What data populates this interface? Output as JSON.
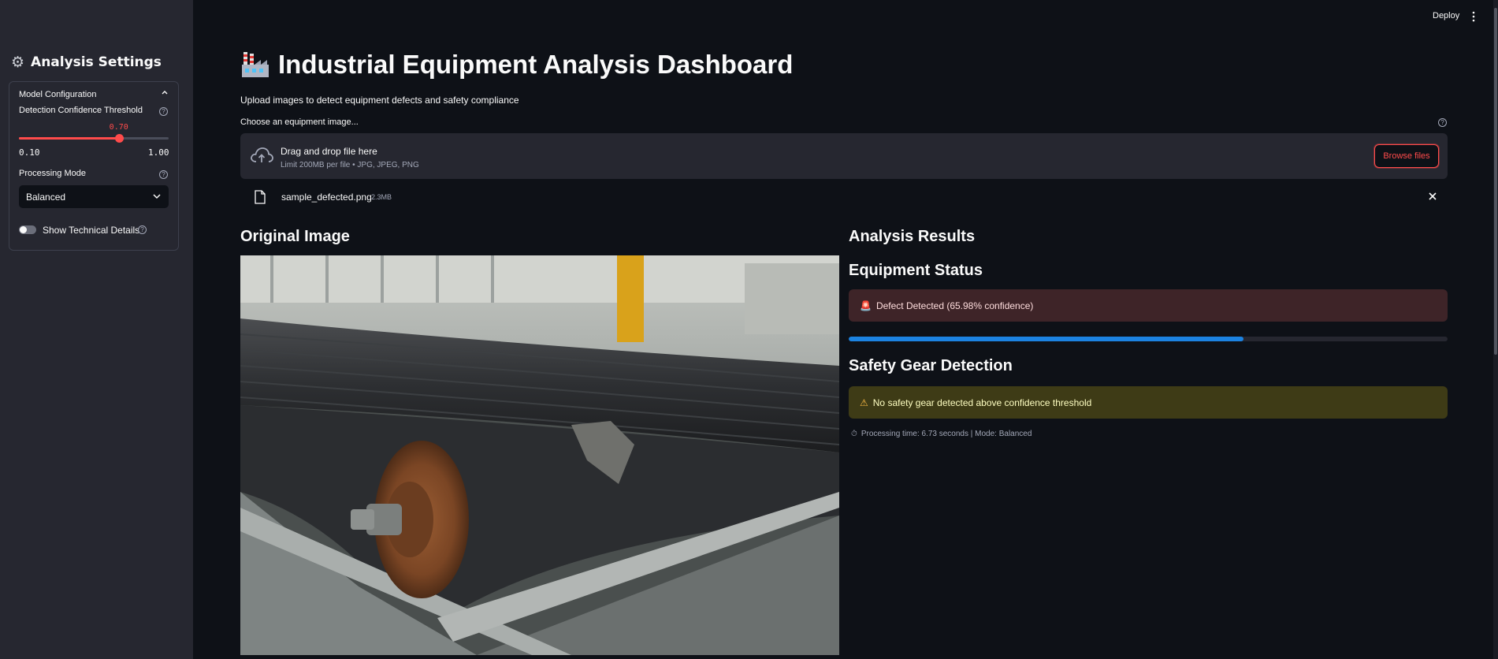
{
  "sidebar": {
    "title": "Analysis Settings",
    "expander": {
      "label": "Model Configuration",
      "slider": {
        "label": "Detection Confidence Threshold",
        "value": "0.70",
        "min": "0.10",
        "max": "1.00",
        "fraction": 0.6667
      },
      "select": {
        "label": "Processing Mode",
        "value": "Balanced"
      },
      "toggle": {
        "label": "Show Technical Details",
        "on": false
      }
    }
  },
  "header": {
    "deploy_label": "Deploy"
  },
  "main": {
    "title": "Industrial Equipment Analysis Dashboard",
    "subtitle": "Upload images to detect equipment defects and safety compliance",
    "uploader": {
      "label": "Choose an equipment image...",
      "drop_text": "Drag and drop file here",
      "limit_text": "Limit 200MB per file • JPG, JPEG, PNG",
      "browse_label": "Browse files",
      "file_name": "sample_defected.png",
      "file_size": "2.3MB"
    },
    "original_image_heading": "Original Image",
    "results": {
      "heading": "Analysis Results",
      "status_heading": "Equipment Status",
      "status_alert": "Defect Detected (65.98% confidence)",
      "confidence": 0.6598,
      "safety_heading": "Safety Gear Detection",
      "safety_alert": "No safety gear detected above confidence threshold",
      "caption": "Processing time: 6.73 seconds | Mode: Balanced"
    }
  },
  "colors": {
    "accent": "#ff4b4b",
    "progress": "#1c83e1",
    "error_bg": "#3e2428",
    "warning_bg": "#3e3b16"
  },
  "icons": [
    "gear-icon",
    "factory-icon",
    "cloud-upload-icon",
    "file-icon",
    "close-icon",
    "siren-icon",
    "warning-icon",
    "stopwatch-icon",
    "help-icon",
    "chevron-up-icon",
    "chevron-down-icon",
    "kebab-menu-icon"
  ]
}
